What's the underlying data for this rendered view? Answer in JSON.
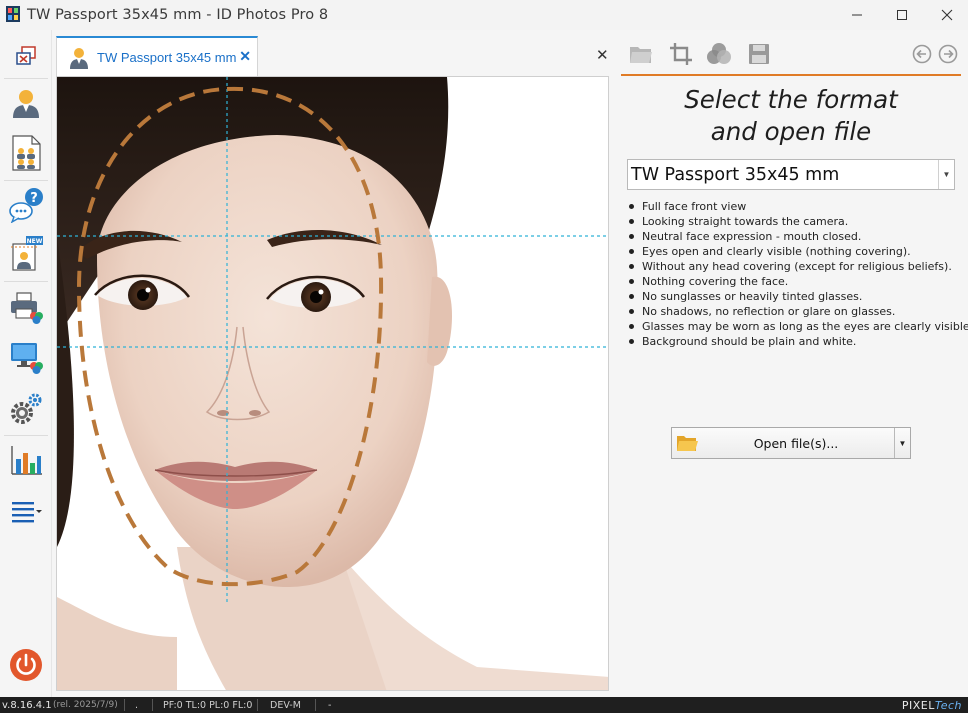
{
  "window": {
    "title": "TW Passport 35x45 mm - ID Photos Pro 8",
    "min_icon": "minimize-icon",
    "max_icon": "maximize-icon",
    "close_icon": "close-icon"
  },
  "sidebar": {
    "items": [
      {
        "name": "close-windows-icon"
      },
      {
        "name": "single-photo-icon"
      },
      {
        "name": "multi-photo-sheet-icon"
      },
      {
        "name": "help-chat-icon"
      },
      {
        "name": "new-template-icon"
      },
      {
        "name": "print-icon"
      },
      {
        "name": "display-colors-icon"
      },
      {
        "name": "settings-icon"
      },
      {
        "name": "statistics-icon"
      },
      {
        "name": "menu-icon"
      },
      {
        "name": "power-icon"
      }
    ]
  },
  "tabs": [
    {
      "label": "TW Passport 35x45 mm",
      "close": "✕",
      "active": true
    }
  ],
  "tabs_close_all": "✕",
  "right_toolbar": {
    "icons": [
      "open-folder-icon",
      "crop-icon",
      "color-adjust-icon",
      "save-icon",
      "back-icon",
      "forward-icon"
    ]
  },
  "panel": {
    "heading_line1": "Select the format",
    "heading_line2": "and open file",
    "format_value": "TW Passport 35x45 mm",
    "requirements": [
      "Full face front view",
      "Looking straight towards the camera.",
      "Neutral face expression - mouth closed.",
      "Eyes open and clearly visible (nothing covering).",
      "Without any head covering (except for religious beliefs).",
      "Nothing covering the face.",
      "No sunglasses or heavily tinted glasses.",
      "No shadows, no reflection or glare on glasses.",
      "Glasses may be worn as long as the eyes are clearly visible.",
      "Background should be plain and white."
    ],
    "open_button_label": "Open file(s)..."
  },
  "statusbar": {
    "version": "v.8.16.4.1",
    "release": "(rel. 2025/7/9)",
    "dot": ".",
    "counters": "PF:0 TL:0 PL:0 FL:0",
    "mode": "DEV-M",
    "dash": "-",
    "brand_a": "PIXEL",
    "brand_b": "Tech"
  },
  "colors": {
    "accent": "#e07b26",
    "tab_blue": "#1a70c8",
    "guide_line": "#2fb2d6",
    "face_oval": "#b9783a"
  }
}
